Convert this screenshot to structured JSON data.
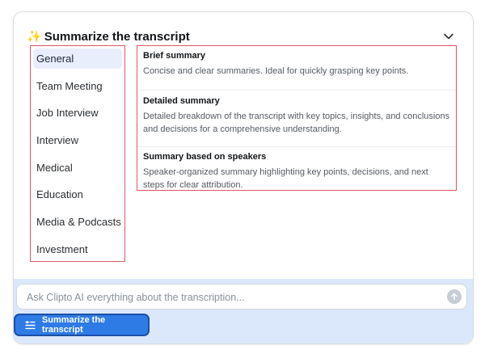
{
  "header": {
    "sparkle_glyph": "✨",
    "title": "Summarize the transcript",
    "collapse_icon": "chevron-down-icon"
  },
  "sidebar": {
    "items": [
      {
        "label": "General",
        "active": true
      },
      {
        "label": "Team Meeting",
        "active": false
      },
      {
        "label": "Job Interview",
        "active": false
      },
      {
        "label": "Interview",
        "active": false
      },
      {
        "label": "Medical",
        "active": false
      },
      {
        "label": "Education",
        "active": false
      },
      {
        "label": "Media & Podcasts",
        "active": false
      },
      {
        "label": "Investment",
        "active": false
      }
    ]
  },
  "options": [
    {
      "title": "Brief summary",
      "description": "Concise and clear summaries. Ideal for quickly grasping key points."
    },
    {
      "title": "Detailed summary",
      "description": "Detailed breakdown of the transcript with key topics, insights, and conclusions and decisions for a comprehensive understanding."
    },
    {
      "title": "Summary based on speakers",
      "description": "Speaker-organized summary highlighting key points, decisions, and next steps for clear attribution."
    }
  ],
  "ask": {
    "placeholder": "Ask Clipto AI everything about the transcription...",
    "value": "",
    "send_icon": "arrow-up-icon"
  },
  "action_chip": {
    "label": "Summarize the transcript",
    "icon": "list-icon"
  },
  "colors": {
    "accent": "#2f7be6",
    "highlight_border": "#e05566",
    "active_item_bg": "#e8eefb",
    "footer_bg": "#dbe8fb"
  }
}
